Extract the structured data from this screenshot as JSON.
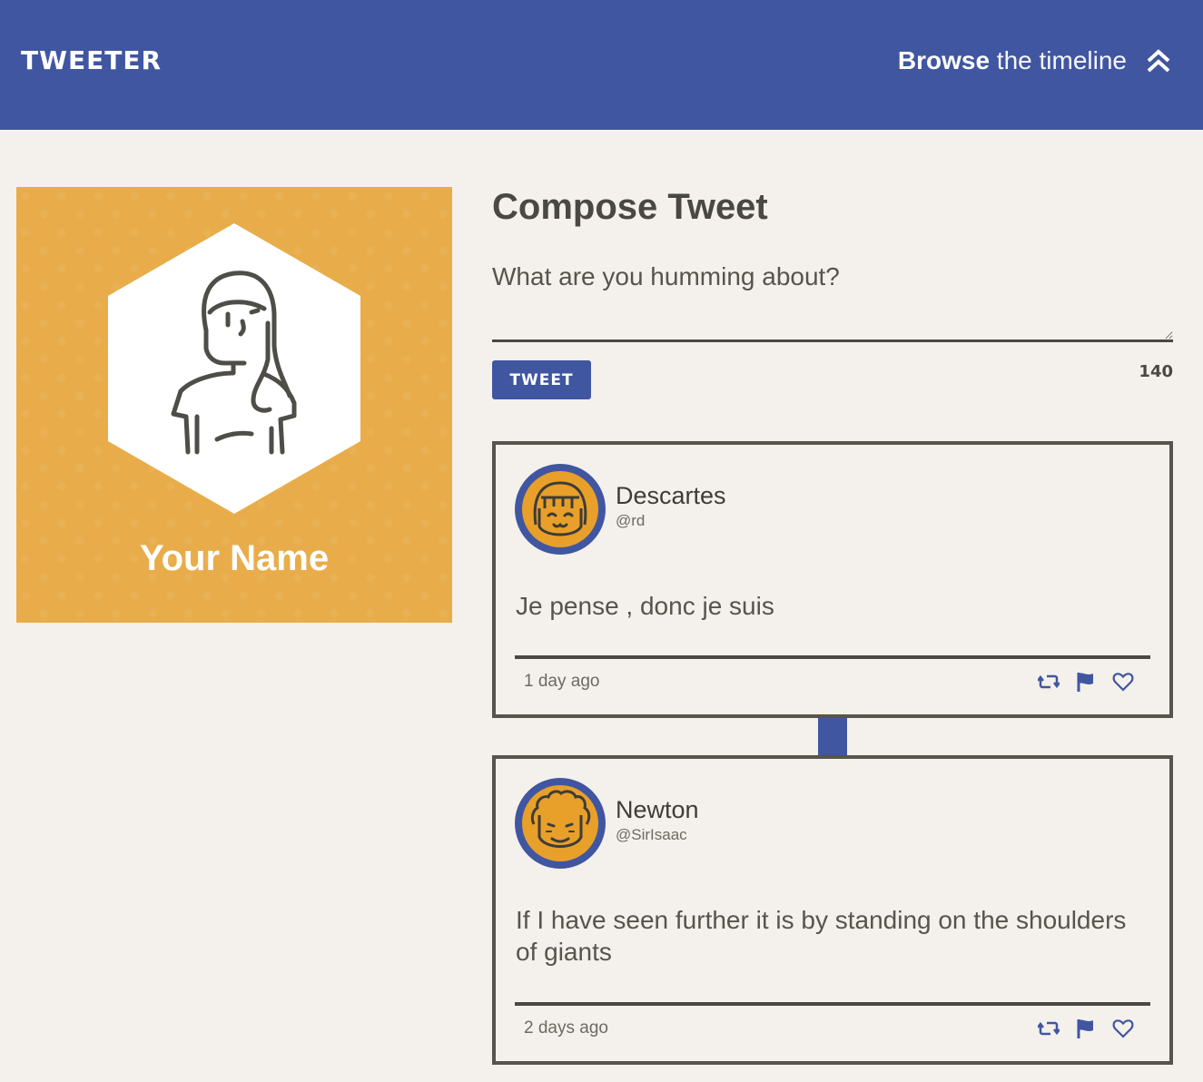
{
  "nav": {
    "brand": "TWEETER",
    "browse_strong": "Browse",
    "browse_rest": " the timeline",
    "toggle_icon": "double-chevron-up-icon"
  },
  "profile": {
    "name": "Your Name",
    "avatar_icon": "user-avatar-icon"
  },
  "compose": {
    "title": "Compose Tweet",
    "placeholder": "What are you humming about?",
    "button_label": "TWEET",
    "counter": "140"
  },
  "tweets": [
    {
      "name": "Descartes",
      "handle": "@rd",
      "text": "Je pense , donc je suis",
      "time": "1 day ago",
      "actions": [
        "retweet-icon",
        "flag-icon",
        "heart-icon"
      ]
    },
    {
      "name": "Newton",
      "handle": "@SirIsaac",
      "text": "If I have seen further it is by standing on the shoulders of giants",
      "time": "2 days ago",
      "actions": [
        "retweet-icon",
        "flag-icon",
        "heart-icon"
      ]
    }
  ],
  "colors": {
    "primary": "#4056a1",
    "accent": "#e8ad4a",
    "background": "#f4f1ec",
    "text": "#4a4842"
  }
}
